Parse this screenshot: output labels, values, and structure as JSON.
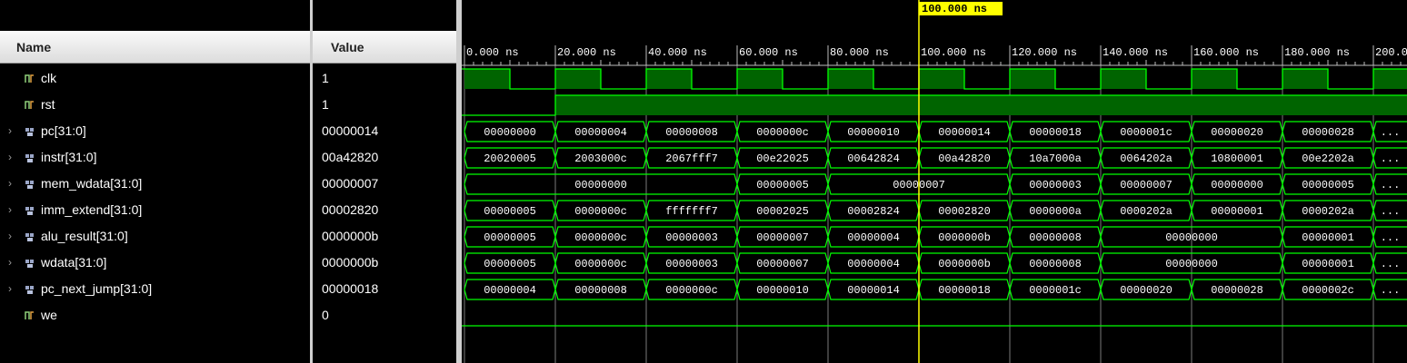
{
  "columns": {
    "name": "Name",
    "value": "Value"
  },
  "cursor": {
    "label": "100.000 ns",
    "time": 100
  },
  "timeline": {
    "start": 0,
    "step": 20,
    "ticks": [
      "0.000 ns",
      "20.000 ns",
      "40.000 ns",
      "60.000 ns",
      "80.000 ns",
      "100.000 ns",
      "120.000 ns",
      "140.000 ns",
      "160.000 ns",
      "180.000 ns",
      "200.0"
    ]
  },
  "colors": {
    "wave": "#00ff00",
    "fill": "#006400",
    "cursor": "#ffff00",
    "text": "#ffffff"
  },
  "signals": [
    {
      "name": "clk",
      "value": "1",
      "kind": "bit",
      "expandable": false,
      "icon": "bit-signal-icon"
    },
    {
      "name": "rst",
      "value": "1",
      "kind": "bit",
      "expandable": false,
      "icon": "bit-signal-icon"
    },
    {
      "name": "pc[31:0]",
      "value": "00000014",
      "kind": "bus",
      "expandable": true,
      "icon": "bus-signal-icon",
      "segments": [
        {
          "t": 0,
          "v": "00000000"
        },
        {
          "t": 20,
          "v": "00000004"
        },
        {
          "t": 40,
          "v": "00000008"
        },
        {
          "t": 60,
          "v": "0000000c"
        },
        {
          "t": 80,
          "v": "00000010"
        },
        {
          "t": 100,
          "v": "00000014"
        },
        {
          "t": 120,
          "v": "00000018"
        },
        {
          "t": 140,
          "v": "0000001c"
        },
        {
          "t": 160,
          "v": "00000020"
        },
        {
          "t": 180,
          "v": "00000028"
        },
        {
          "t": 200,
          "v": "..."
        }
      ]
    },
    {
      "name": "instr[31:0]",
      "value": "00a42820",
      "kind": "bus",
      "expandable": true,
      "icon": "bus-signal-icon",
      "segments": [
        {
          "t": 0,
          "v": "20020005"
        },
        {
          "t": 20,
          "v": "2003000c"
        },
        {
          "t": 40,
          "v": "2067fff7"
        },
        {
          "t": 60,
          "v": "00e22025"
        },
        {
          "t": 80,
          "v": "00642824"
        },
        {
          "t": 100,
          "v": "00a42820"
        },
        {
          "t": 120,
          "v": "10a7000a"
        },
        {
          "t": 140,
          "v": "0064202a"
        },
        {
          "t": 160,
          "v": "10800001"
        },
        {
          "t": 180,
          "v": "00e2202a"
        },
        {
          "t": 200,
          "v": "..."
        }
      ]
    },
    {
      "name": "mem_wdata[31:0]",
      "value": "00000007",
      "kind": "bus",
      "expandable": true,
      "icon": "bus-signal-icon",
      "segments": [
        {
          "t": 0,
          "v": "00000000"
        },
        {
          "t": 60,
          "v": "00000005"
        },
        {
          "t": 80,
          "v": "00000007"
        },
        {
          "t": 120,
          "v": "00000003"
        },
        {
          "t": 140,
          "v": "00000007"
        },
        {
          "t": 160,
          "v": "00000000"
        },
        {
          "t": 180,
          "v": "00000005"
        },
        {
          "t": 200,
          "v": "..."
        }
      ]
    },
    {
      "name": "imm_extend[31:0]",
      "value": "00002820",
      "kind": "bus",
      "expandable": true,
      "icon": "bus-signal-icon",
      "segments": [
        {
          "t": 0,
          "v": "00000005"
        },
        {
          "t": 20,
          "v": "0000000c"
        },
        {
          "t": 40,
          "v": "fffffff7"
        },
        {
          "t": 60,
          "v": "00002025"
        },
        {
          "t": 80,
          "v": "00002824"
        },
        {
          "t": 100,
          "v": "00002820"
        },
        {
          "t": 120,
          "v": "0000000a"
        },
        {
          "t": 140,
          "v": "0000202a"
        },
        {
          "t": 160,
          "v": "00000001"
        },
        {
          "t": 180,
          "v": "0000202a"
        },
        {
          "t": 200,
          "v": "..."
        }
      ]
    },
    {
      "name": "alu_result[31:0]",
      "value": "0000000b",
      "kind": "bus",
      "expandable": true,
      "icon": "bus-signal-icon",
      "segments": [
        {
          "t": 0,
          "v": "00000005"
        },
        {
          "t": 20,
          "v": "0000000c"
        },
        {
          "t": 40,
          "v": "00000003"
        },
        {
          "t": 60,
          "v": "00000007"
        },
        {
          "t": 80,
          "v": "00000004"
        },
        {
          "t": 100,
          "v": "0000000b"
        },
        {
          "t": 120,
          "v": "00000008"
        },
        {
          "t": 140,
          "v": "00000000"
        },
        {
          "t": 180,
          "v": "00000001"
        },
        {
          "t": 200,
          "v": "..."
        }
      ]
    },
    {
      "name": "wdata[31:0]",
      "value": "0000000b",
      "kind": "bus",
      "expandable": true,
      "icon": "bus-signal-icon",
      "segments": [
        {
          "t": 0,
          "v": "00000005"
        },
        {
          "t": 20,
          "v": "0000000c"
        },
        {
          "t": 40,
          "v": "00000003"
        },
        {
          "t": 60,
          "v": "00000007"
        },
        {
          "t": 80,
          "v": "00000004"
        },
        {
          "t": 100,
          "v": "0000000b"
        },
        {
          "t": 120,
          "v": "00000008"
        },
        {
          "t": 140,
          "v": "00000000"
        },
        {
          "t": 180,
          "v": "00000001"
        },
        {
          "t": 200,
          "v": "..."
        }
      ]
    },
    {
      "name": "pc_next_jump[31:0]",
      "value": "00000018",
      "kind": "bus",
      "expandable": true,
      "icon": "bus-signal-icon",
      "segments": [
        {
          "t": 0,
          "v": "00000004"
        },
        {
          "t": 20,
          "v": "00000008"
        },
        {
          "t": 40,
          "v": "0000000c"
        },
        {
          "t": 60,
          "v": "00000010"
        },
        {
          "t": 80,
          "v": "00000014"
        },
        {
          "t": 100,
          "v": "00000018"
        },
        {
          "t": 120,
          "v": "0000001c"
        },
        {
          "t": 140,
          "v": "00000020"
        },
        {
          "t": 160,
          "v": "00000028"
        },
        {
          "t": 180,
          "v": "0000002c"
        },
        {
          "t": 200,
          "v": "..."
        }
      ]
    },
    {
      "name": "we",
      "value": "0",
      "kind": "bit",
      "expandable": false,
      "icon": "bit-signal-icon"
    }
  ],
  "bit_waves": {
    "clk": {
      "initial": 1,
      "edges": [
        10,
        20,
        30,
        40,
        50,
        60,
        70,
        80,
        90,
        100,
        110,
        120,
        130,
        140,
        150,
        160,
        170,
        180,
        190,
        200
      ]
    },
    "rst": {
      "initial": 0,
      "edges": [
        20
      ]
    },
    "we": {
      "initial": 0,
      "edges": []
    }
  }
}
